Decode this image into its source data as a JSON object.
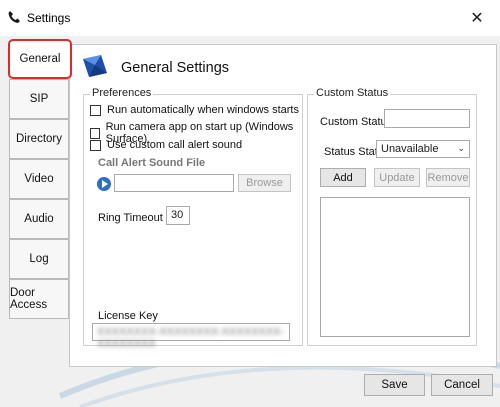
{
  "window": {
    "title": "Settings"
  },
  "tabs": [
    {
      "label": "General"
    },
    {
      "label": "SIP"
    },
    {
      "label": "Directory"
    },
    {
      "label": "Video"
    },
    {
      "label": "Audio"
    },
    {
      "label": "Log"
    },
    {
      "label": "Door Access"
    }
  ],
  "header": {
    "title": "General Settings"
  },
  "preferences": {
    "label": "Preferences",
    "checkboxes": [
      {
        "label": "Run automatically when windows starts",
        "checked": false
      },
      {
        "label": "Run camera app on start up (Windows Surface)",
        "checked": false
      },
      {
        "label": "Use custom call alert sound",
        "checked": false
      }
    ],
    "sound_file_label": "Call Alert Sound File",
    "sound_file_value": "",
    "browse_label": "Browse",
    "ring_timeout_label": "Ring Timeout",
    "ring_timeout_value": "30",
    "license_label": "License Key",
    "license_value": "XXXXXXXX-XXXXXXXX-XXXXXXXX-XXXXXXXX"
  },
  "custom_status": {
    "label": "Custom Status",
    "field_label": "Custom Status",
    "field_value": "",
    "state_label": "Status State",
    "state_value": "Unavailable",
    "add_label": "Add",
    "update_label": "Update",
    "remove_label": "Remove"
  },
  "footer": {
    "save_label": "Save",
    "cancel_label": "Cancel"
  },
  "colors": {
    "active_tab_border": "#e02a2a",
    "accent_blue": "#2f6fc2"
  },
  "icons": {
    "title": "phone-icon",
    "header": "settings-header-icon",
    "close": "close-icon",
    "play": "play-icon",
    "dropdown": "chevron-down-icon"
  }
}
